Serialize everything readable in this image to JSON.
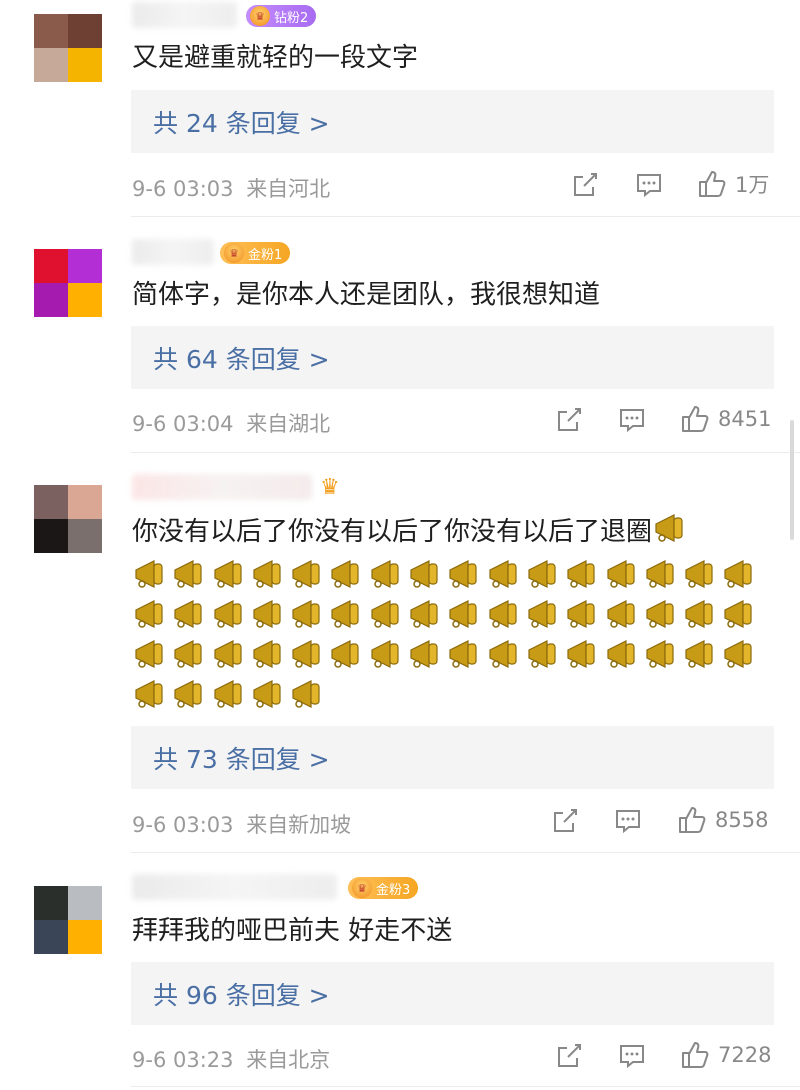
{
  "comments": [
    {
      "badge_label": "钻粉2",
      "text": "又是避重就轻的一段文字",
      "replies": "共 24 条回复 >",
      "time": "9-6 03:03",
      "location": "来自河北",
      "likes": "1万",
      "avatar_colors": [
        "#8a5a4a",
        "#6e3f33",
        "#c7a99a",
        "#f4b400"
      ]
    },
    {
      "badge_label": "金粉1",
      "text": "简体字，是你本人还是团队，我很想知道",
      "replies": "共 64 条回复 >",
      "time": "9-6 03:04",
      "location": "来自湖北",
      "likes": "8451",
      "avatar_colors": [
        "#e0112f",
        "#b42ed6",
        "#a51bb0",
        "#ffb000"
      ]
    },
    {
      "text": "你没有以后了你没有以后了你没有以后了退圈",
      "horn_count": 53,
      "replies": "共 73 条回复 >",
      "time": "9-6 03:03",
      "location": "来自新加坡",
      "likes": "8558",
      "avatar_colors": [
        "#7b6260",
        "#d9a794",
        "#1b1717",
        "#7a6f6d"
      ]
    },
    {
      "badge_label": "金粉3",
      "text": "拜拜我的哑巴前夫 好走不送",
      "replies": "共 96 条回复 >",
      "time": "9-6 03:23",
      "location": "来自北京",
      "likes": "7228",
      "avatar_colors": [
        "#2b2f2b",
        "#b9bcc1",
        "#3a4658",
        "#ffb000"
      ]
    }
  ]
}
